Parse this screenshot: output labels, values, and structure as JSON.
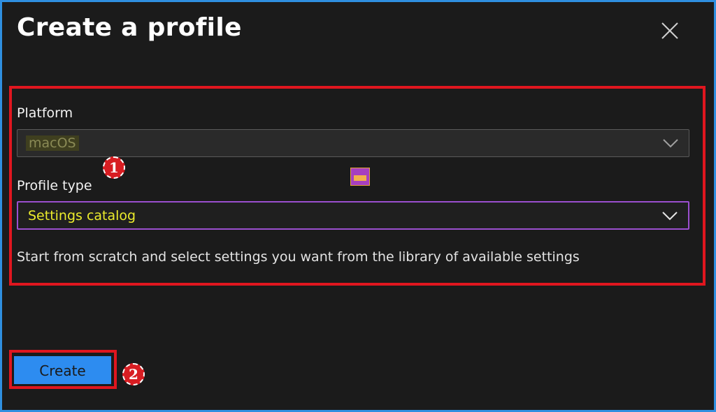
{
  "dialog": {
    "title": "Create a profile",
    "close_icon": "close-icon"
  },
  "form": {
    "platform_label": "Platform",
    "platform_value": "macOS",
    "profile_type_label": "Profile type",
    "profile_type_value": "Settings catalog",
    "description": "Start from scratch and select settings you want from the library of available settings"
  },
  "annotations": {
    "step1": "1",
    "step2": "2"
  },
  "footer": {
    "create_label": "Create"
  },
  "colors": {
    "accent_blue": "#2d8cf0",
    "highlight_red": "#e0161f",
    "focus_purple": "#9b4fcf",
    "value_yellow": "#ecec2c"
  }
}
